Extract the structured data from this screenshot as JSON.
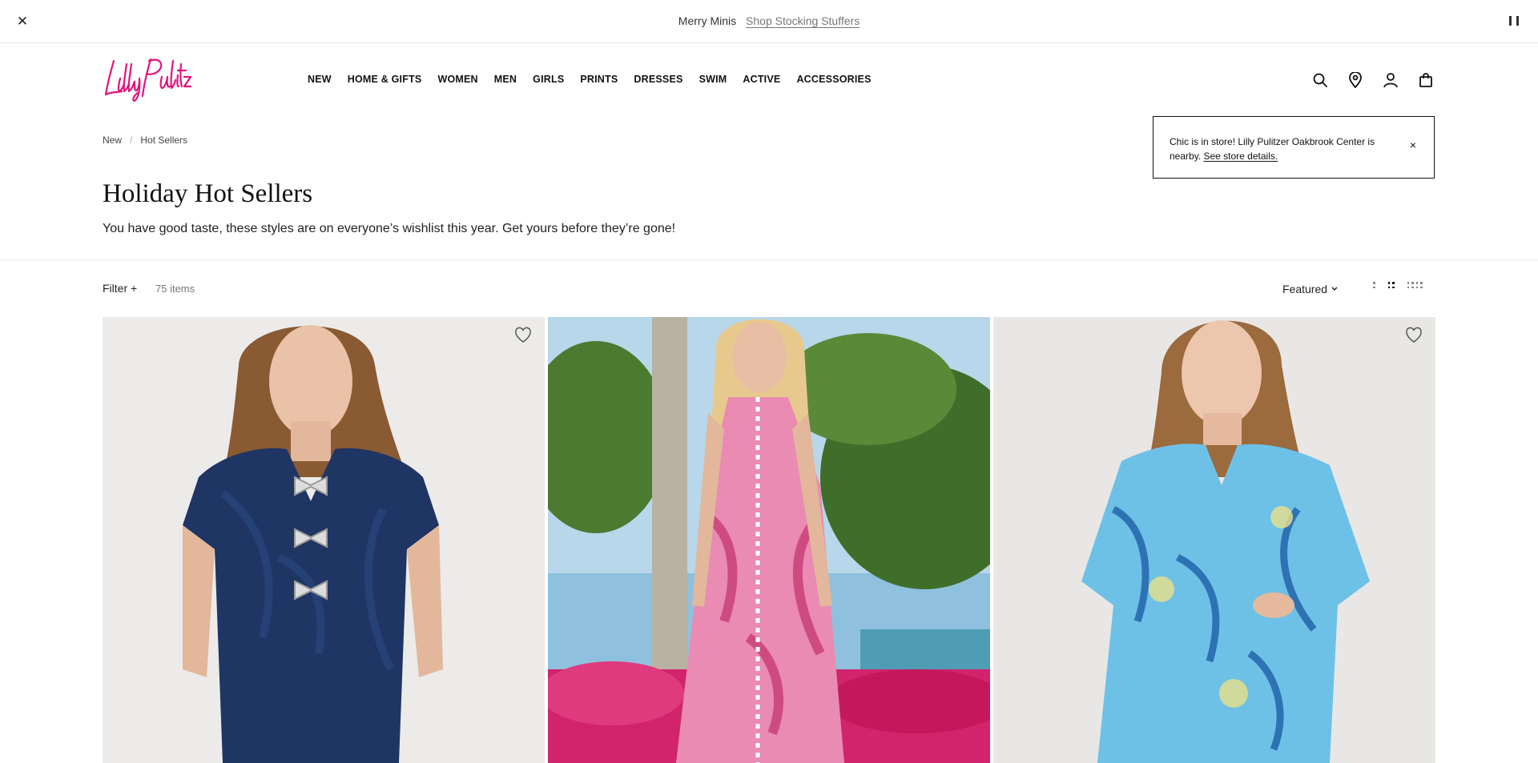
{
  "promo": {
    "text": "Merry Minis",
    "link": "Shop Stocking Stuffers",
    "close_icon": "close-icon",
    "pause_icon": "pause-icon"
  },
  "brand": {
    "logo": "Lilly Pulitzer",
    "color": "#e4127d"
  },
  "nav": [
    "NEW",
    "HOME & GIFTS",
    "WOMEN",
    "MEN",
    "GIRLS",
    "PRINTS",
    "DRESSES",
    "SWIM",
    "ACTIVE",
    "ACCESSORIES"
  ],
  "utilities": [
    "search-icon",
    "location-pin-icon",
    "account-icon",
    "shopping-bag-icon"
  ],
  "breadcrumb": {
    "items": [
      "New",
      "Hot Sellers"
    ],
    "separator": "/"
  },
  "store_notice": {
    "text": "Chic is in store! Lilly Pulitzer Oakbrook Center is nearby.",
    "link": "See store details.",
    "close": "×"
  },
  "page": {
    "title": "Holiday Hot Sellers",
    "subtitle": "You have good taste, these styles are on everyone’s wishlist this year. Get yours before they’re gone!"
  },
  "toolbar": {
    "filter_label": "Filter +",
    "item_count": "75 items",
    "sort_label": "Featured",
    "grid_options": [
      "1-column",
      "2-column",
      "3-column"
    ],
    "active_grid": "2-column"
  },
  "products": [
    {
      "image": "navy jacquard dress with bow buttons",
      "wishlist": true,
      "wishlist_icon": "heart-icon"
    },
    {
      "image": "pink floral print maxi dress by palm trees",
      "wishlist": false
    },
    {
      "image": "light blue floral print long sleeve dress",
      "wishlist": true,
      "wishlist_icon": "heart-icon"
    }
  ],
  "colors": {
    "text": "#111111",
    "muted": "#777777",
    "divider": "#ececec"
  }
}
